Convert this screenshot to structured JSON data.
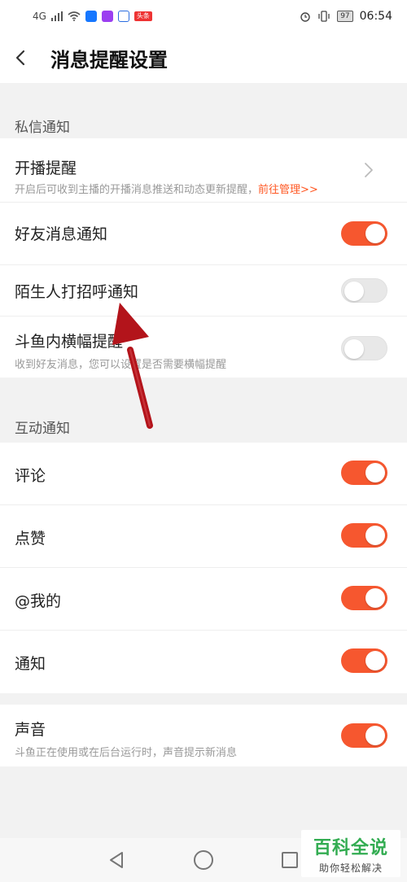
{
  "status_bar": {
    "signal": "4G",
    "news_badge": "头条",
    "battery": "97",
    "time": "06:54"
  },
  "header": {
    "title": "消息提醒设置"
  },
  "sections": {
    "private": {
      "label": "私信通知",
      "items": {
        "live": {
          "title": "开播提醒",
          "subtitle": "开启后可收到主播的开播消息推送和动态更新提醒，",
          "link": "前往管理>>"
        },
        "friend": {
          "title": "好友消息通知",
          "state": "on"
        },
        "stranger": {
          "title": "陌生人打招呼通知",
          "state": "off"
        },
        "banner": {
          "title": "斗鱼内横幅提醒",
          "subtitle": "收到好友消息，您可以设置是否需要横幅提醒",
          "state": "off"
        }
      }
    },
    "interaction": {
      "label": "互动通知",
      "items": {
        "comment": {
          "title": "评论",
          "state": "on"
        },
        "like": {
          "title": "点赞",
          "state": "on"
        },
        "mention": {
          "title": "@我的",
          "state": "on"
        },
        "notify": {
          "title": "通知",
          "state": "on"
        }
      }
    },
    "sound": {
      "title": "声音",
      "subtitle": "斗鱼正在使用或在后台运行时，声音提示新消息",
      "state": "on"
    }
  },
  "watermark": {
    "main": "百科全说",
    "sub": "助你轻松解决"
  },
  "colors": {
    "toggle_on": "#f6572f",
    "toggle_off": "#e8e8e8",
    "link": "#ff5722",
    "annotation_arrow": "#b3141b",
    "watermark": "#2aa94b"
  },
  "icons": {
    "back": "chevron-left-icon",
    "row_next": "chevron-right-icon",
    "nav_back": "triangle-back-icon",
    "nav_home": "circle-home-icon",
    "nav_recent": "square-recent-icon"
  }
}
